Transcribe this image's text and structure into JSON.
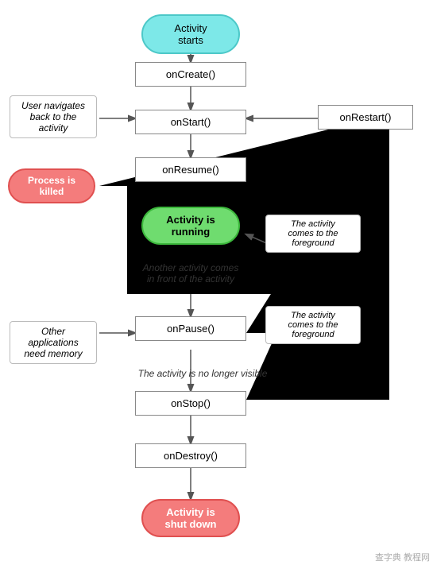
{
  "nodes": {
    "activity_starts": "Activity\nstarts",
    "onCreate": "onCreate()",
    "onStart": "onStart()",
    "onRestart": "onRestart()",
    "onResume": "onResume()",
    "activity_running": "Activity is\nrunning",
    "onPause": "onPause()",
    "onStop": "onStop()",
    "onDestroy": "onDestroy()",
    "activity_shutdown": "Activity is\nshut down"
  },
  "labels": {
    "user_navigates": "User navigates\nback to the\nactivity",
    "process_killed": "Process is\nkilled",
    "another_activity": "Another activity comes\nin front of the activity",
    "other_apps": "Other applications\nneed memory",
    "not_visible": "The activity is no longer visible",
    "comes_foreground_1": "The activity\ncomes to the\nforeground",
    "comes_foreground_2": "The activity\ncomes to the\nforeground"
  }
}
